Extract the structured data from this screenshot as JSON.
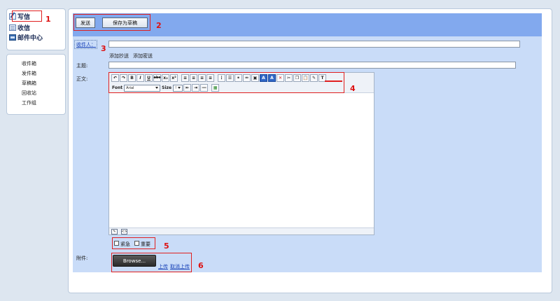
{
  "sidebar": {
    "top_menu": [
      {
        "label": "写信",
        "icon": "write-icon"
      },
      {
        "label": "收信",
        "icon": "inbox-icon"
      },
      {
        "label": "邮件中心",
        "icon": "mail-center-icon"
      }
    ],
    "folders": [
      "收件箱",
      "发件箱",
      "草稿箱",
      "回收站",
      "工作组"
    ]
  },
  "toolbar": {
    "send_label": "发送",
    "save_draft_label": "保存为草稿"
  },
  "compose": {
    "recipient_link": "收件人：",
    "recipient_value": "",
    "add_cc": "添加抄送",
    "add_bcc": "添加密送",
    "subject_label": "主题:",
    "subject_value": "",
    "body_label": "正文:"
  },
  "editor": {
    "font_label": "Font",
    "font_value": "Arial",
    "size_label": "Size",
    "size_value": "!",
    "body_text": ""
  },
  "options": {
    "urgent_label": "紧急",
    "important_label": "重要"
  },
  "attachment": {
    "label": "附件:",
    "browse_label": "Browse...",
    "upload_link": "上传",
    "cancel_upload_link": "取消上传"
  },
  "annotations": [
    "1",
    "2",
    "3",
    "4",
    "5",
    "6"
  ],
  "colors": {
    "highlight": "#e02020",
    "toolbar_blue": "#82a9ee",
    "form_bg": "#c9dcf8",
    "page_bg": "#dde6f0"
  }
}
